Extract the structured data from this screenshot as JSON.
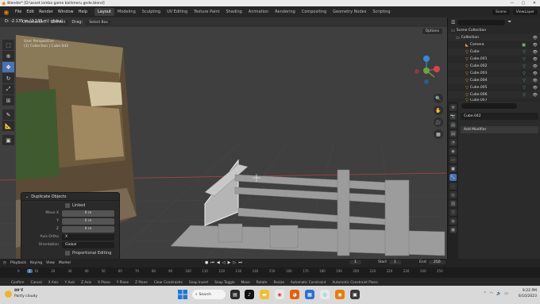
{
  "window": {
    "title": "Blender* [D:\\asset iomba game bali\\meru gede.blend]",
    "controls": [
      "—",
      "▢",
      "✕"
    ]
  },
  "menu": [
    "File",
    "Edit",
    "Render",
    "Window",
    "Help"
  ],
  "workspaces": [
    "Layout",
    "Modeling",
    "Sculpting",
    "UV Editing",
    "Texture Paint",
    "Shading",
    "Animation",
    "Rendering",
    "Compositing",
    "Geometry Nodes",
    "Scripting"
  ],
  "active_workspace": "Layout",
  "scene": {
    "label": "Scene",
    "viewlayer": "ViewLayer"
  },
  "viewport": {
    "distance_readout": "D: -2.135 m (2.135 m) global",
    "orientation_label": "Orientation:",
    "orientation_value": "Default",
    "drag_label": "Drag:",
    "drag_value": "Select Box",
    "options": "Options",
    "overlay_line1": "User Perspective",
    "overlay_line2": "(1) Collection | Cube.042"
  },
  "op_panel": {
    "title": "Duplicate Objects",
    "linked": "Linked",
    "move_x_label": "Move X",
    "move_x": "0 m",
    "y_label": "Y",
    "y": "0 m",
    "z_label": "Z",
    "z": "0 m",
    "axis_ortho_label": "Axis Ortho",
    "axis_ortho": "X",
    "orientation_label": "Orientation",
    "orientation": "Global",
    "proportional": "Proportional Editing"
  },
  "outliner": {
    "scene_collection": "Scene Collection",
    "collection": "Collection",
    "items": [
      "Camera",
      "Cube",
      "Cube.001",
      "Cube.002",
      "Cube.003",
      "Cube.004",
      "Cube.005",
      "Cube.006",
      "Cube.007"
    ]
  },
  "properties": {
    "object_name": "Cube.042",
    "add_modifier": "Add Modifier"
  },
  "timeline": {
    "menus": [
      "Playback",
      "Keying",
      "View",
      "Marker"
    ],
    "current_frame": "1",
    "start_label": "Start",
    "start": "1",
    "end_label": "End",
    "end": "250",
    "ticks": [
      "0",
      "10",
      "20",
      "30",
      "40",
      "50",
      "60",
      "70",
      "80",
      "90",
      "100",
      "110",
      "120",
      "130",
      "140",
      "150",
      "160",
      "170",
      "180",
      "190",
      "200",
      "210",
      "220",
      "230",
      "240",
      "250"
    ],
    "cursor_tick": "1"
  },
  "statusbar": [
    "Confirm",
    "Cancel",
    "X Axis",
    "Y Axis",
    "Z Axis",
    "X Plane",
    "Y Plane",
    "Z Plane",
    "Clear Constraints",
    "Snap Invert",
    "Snap Toggle",
    "Move",
    "Rotate",
    "Resize",
    "Automatic Constraint",
    "Automatic Constraint Plane"
  ],
  "taskbar": {
    "temp": "89°F",
    "weather": "Partly cloudy",
    "search": "Search",
    "time": "9:22 PM",
    "date": "6/10/2023"
  },
  "colors": {
    "accent": "#4772b3",
    "blender_orange": "#e87d0d",
    "x_axis": "#e0404a",
    "y_axis": "#6ba53a",
    "z_axis": "#3a86d8"
  }
}
